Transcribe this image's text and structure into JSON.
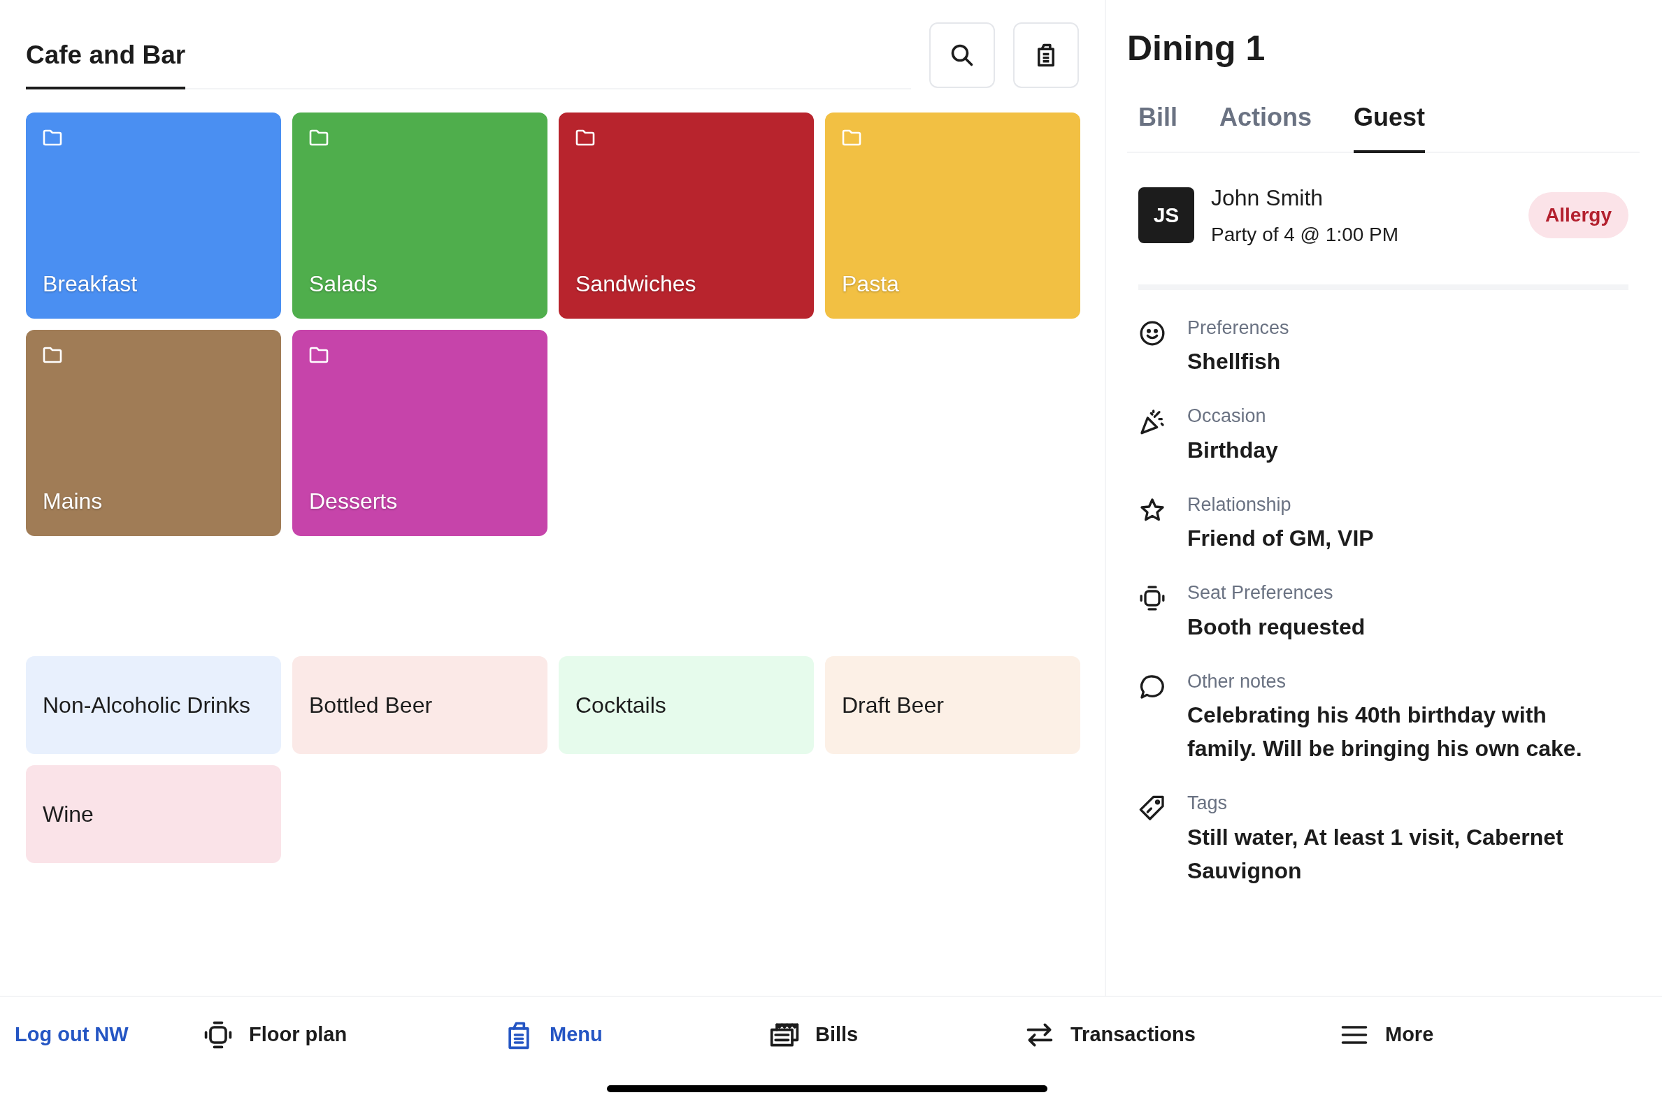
{
  "menu": {
    "title": "Cafe and Bar",
    "folders": [
      {
        "label": "Breakfast",
        "color": "#4a8ff2"
      },
      {
        "label": "Salads",
        "color": "#4fae4c"
      },
      {
        "label": "Sandwiches",
        "color": "#b8242d"
      },
      {
        "label": "Pasta",
        "color": "#f2c043"
      },
      {
        "label": "Mains",
        "color": "#a07c56"
      },
      {
        "label": "Desserts",
        "color": "#c644aa"
      }
    ],
    "drink_categories": [
      {
        "label": "Non-Alcoholic Drinks",
        "color": "#e8f0fd"
      },
      {
        "label": "Bottled Beer",
        "color": "#fbe9e7"
      },
      {
        "label": "Cocktails",
        "color": "#e6fbec"
      },
      {
        "label": "Draft Beer",
        "color": "#fcf0e6"
      },
      {
        "label": "Wine",
        "color": "#fae3e8"
      }
    ]
  },
  "guest_panel": {
    "title": "Dining 1",
    "tabs": [
      {
        "label": "Bill",
        "selected": false
      },
      {
        "label": "Actions",
        "selected": false
      },
      {
        "label": "Guest",
        "selected": true
      }
    ],
    "guest": {
      "initials": "JS",
      "name": "John Smith",
      "party": "Party of 4 @ 1:00 PM",
      "badge": "Allergy"
    },
    "details": [
      {
        "kind": "preferences",
        "label": "Preferences",
        "value": "Shellfish"
      },
      {
        "kind": "occasion",
        "label": "Occasion",
        "value": "Birthday"
      },
      {
        "kind": "relationship",
        "label": "Relationship",
        "value": "Friend of GM, VIP"
      },
      {
        "kind": "seat",
        "label": "Seat Preferences",
        "value": "Booth requested"
      },
      {
        "kind": "notes",
        "label": "Other notes",
        "value": "Celebrating his 40th birthday with family. Will be bringing his own cake."
      },
      {
        "kind": "tags",
        "label": "Tags",
        "value": "Still water, At least 1 visit, Cabernet Sauvignon"
      }
    ]
  },
  "bottom_nav": {
    "logout": "Log out NW",
    "items": [
      {
        "kind": "floor",
        "label": "Floor plan",
        "selected": false
      },
      {
        "kind": "menu",
        "label": "Menu",
        "selected": true
      },
      {
        "kind": "bills",
        "label": "Bills",
        "selected": false
      },
      {
        "kind": "transactions",
        "label": "Transactions",
        "selected": false
      },
      {
        "kind": "more",
        "label": "More",
        "selected": false
      }
    ]
  }
}
